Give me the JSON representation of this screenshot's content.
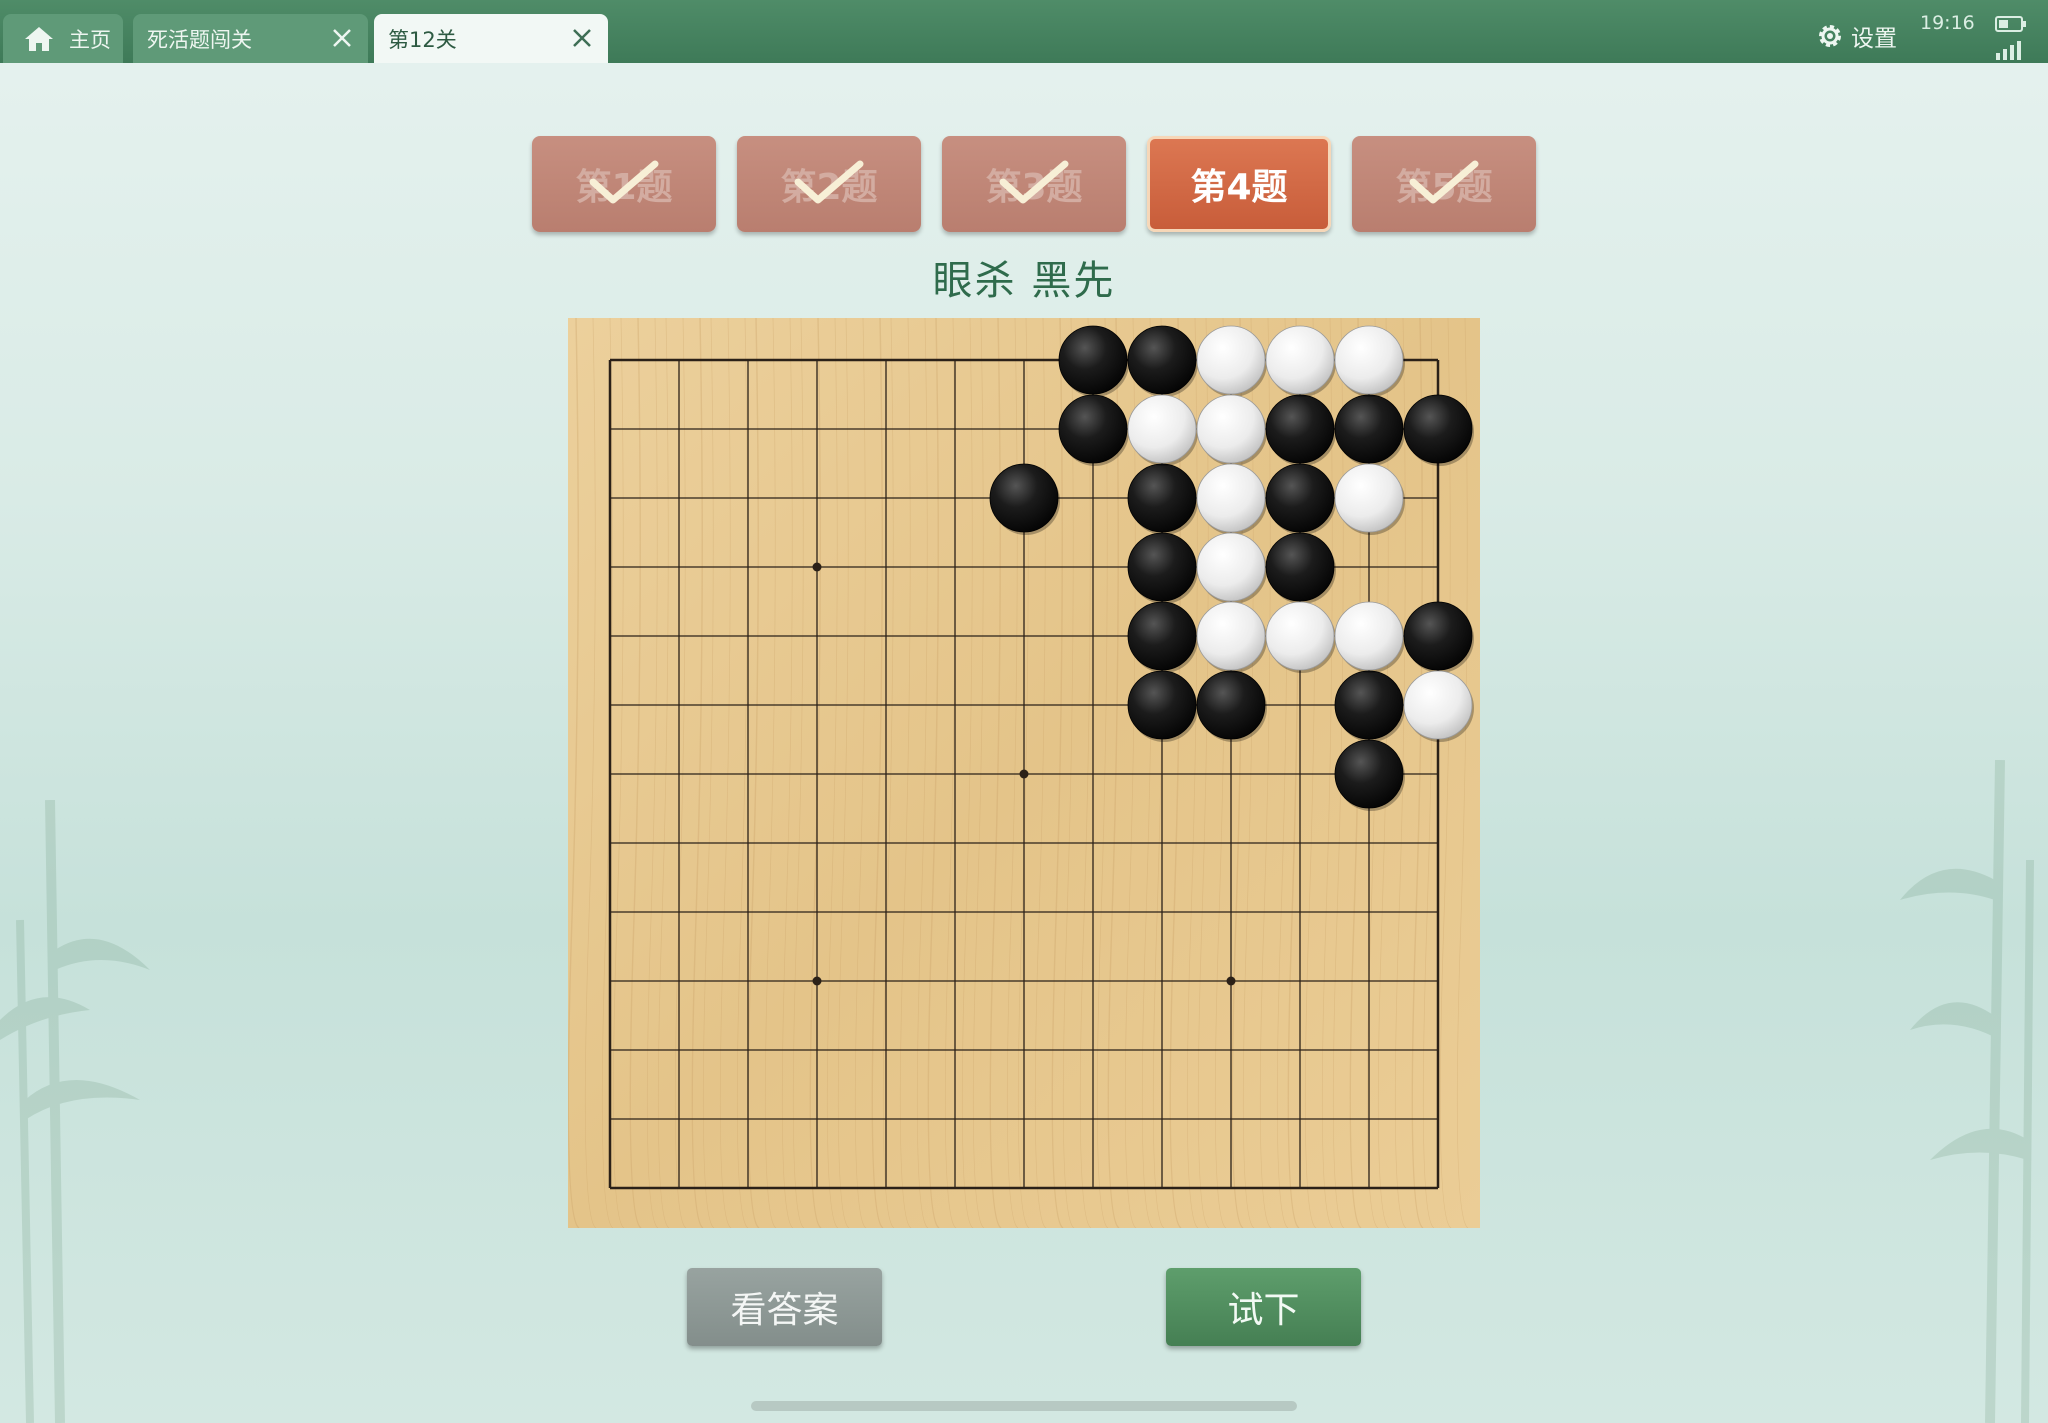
{
  "tabs": {
    "home_label": "主页",
    "level_label": "死活题闯关",
    "active_label": "第12关"
  },
  "status": {
    "settings_label": "设置",
    "time": "19:16"
  },
  "questions": [
    {
      "label": "第1题",
      "completed": true,
      "active": false
    },
    {
      "label": "第2题",
      "completed": true,
      "active": false
    },
    {
      "label": "第3题",
      "completed": true,
      "active": false
    },
    {
      "label": "第4题",
      "completed": false,
      "active": true
    },
    {
      "label": "第5题",
      "completed": true,
      "active": false
    }
  ],
  "problem": {
    "title": "眼杀  黑先"
  },
  "board": {
    "size": 13,
    "star_points": [
      [
        3,
        3
      ],
      [
        6,
        6
      ],
      [
        3,
        9
      ],
      [
        9,
        9
      ]
    ],
    "black_stones": [
      [
        7,
        0
      ],
      [
        8,
        0
      ],
      [
        7,
        1
      ],
      [
        10,
        1
      ],
      [
        11,
        1
      ],
      [
        12,
        1
      ],
      [
        6,
        2
      ],
      [
        8,
        2
      ],
      [
        10,
        2
      ],
      [
        8,
        3
      ],
      [
        10,
        3
      ],
      [
        8,
        4
      ],
      [
        12,
        4
      ],
      [
        8,
        5
      ],
      [
        9,
        5
      ],
      [
        11,
        5
      ],
      [
        11,
        6
      ]
    ],
    "white_stones": [
      [
        9,
        0
      ],
      [
        10,
        0
      ],
      [
        11,
        0
      ],
      [
        8,
        1
      ],
      [
        9,
        1
      ],
      [
        9,
        2
      ],
      [
        11,
        2
      ],
      [
        9,
        3
      ],
      [
        9,
        4
      ],
      [
        10,
        4
      ],
      [
        11,
        4
      ],
      [
        12,
        5
      ]
    ]
  },
  "actions": {
    "answer_label": "看答案",
    "try_label": "试下"
  },
  "colors": {
    "topbar": "#3e7a58",
    "active_question": "#dc7752",
    "done_question": "#c78f80",
    "board": "#e6c48a"
  }
}
